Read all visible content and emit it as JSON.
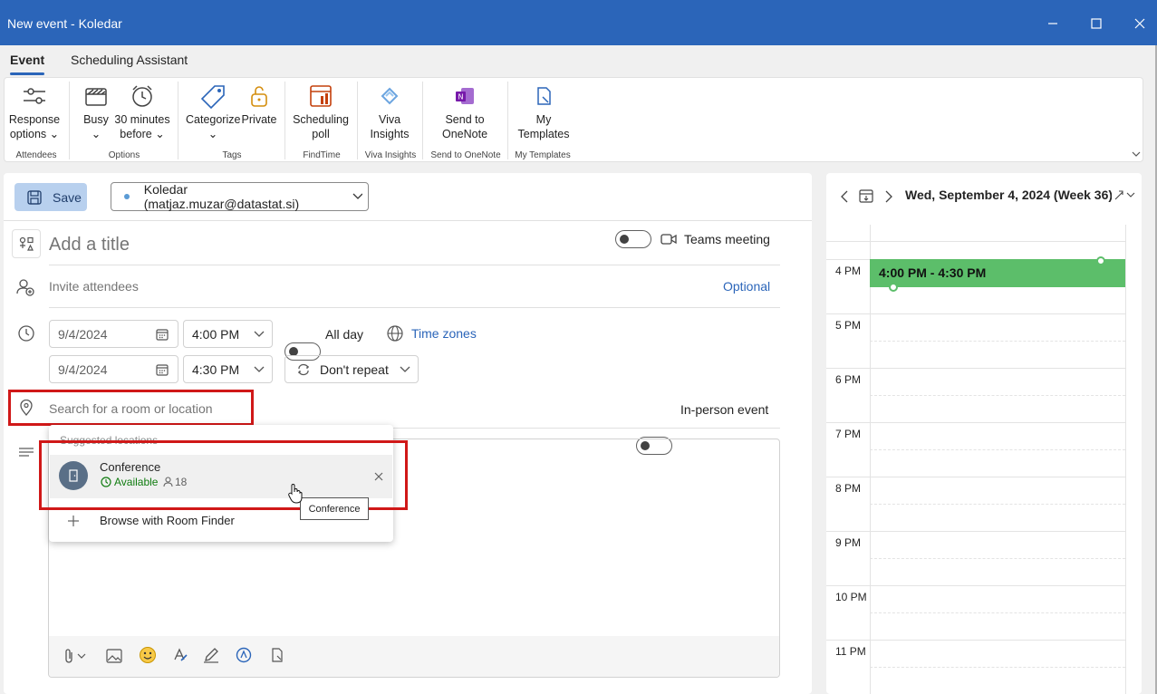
{
  "window": {
    "title": "New event - Koledar"
  },
  "tabs": [
    {
      "label": "Event"
    },
    {
      "label": "Scheduling Assistant"
    }
  ],
  "ribbon": {
    "response_options": "Response options",
    "busy": "Busy",
    "reminder": "30 minutes before",
    "categorize": "Categorize",
    "private": "Private",
    "scheduling_poll": "Scheduling poll",
    "viva_insights": "Viva Insights",
    "send_onenote": "Send to OneNote",
    "my_templates": "My Templates",
    "groups": {
      "attendees": "Attendees",
      "options": "Options",
      "tags": "Tags",
      "findtime": "FindTime",
      "viva": "Viva Insights",
      "onenote": "Send to OneNote",
      "templates": "My Templates"
    }
  },
  "form": {
    "save_label": "Save",
    "account": "Koledar (matjaz.muzar@datastat.si)",
    "title_placeholder": "Add a title",
    "teams_meeting": "Teams meeting",
    "invite_placeholder": "Invite attendees",
    "optional": "Optional",
    "start_date": "9/4/2024",
    "start_time": "4:00 PM",
    "all_day": "All day",
    "time_zones": "Time zones",
    "end_date": "9/4/2024",
    "end_time": "4:30 PM",
    "repeat": "Don't repeat",
    "location_placeholder": "Search for a room or location",
    "in_person": "In-person event"
  },
  "suggestions": {
    "header": "Suggested locations",
    "room_name": "Conference",
    "room_status": "Available",
    "room_capacity": "18",
    "browse": "Browse with Room Finder",
    "tooltip": "Conference"
  },
  "calendar": {
    "date_header": "Wed, September 4, 2024 (Week 36)",
    "hours": [
      "4 PM",
      "5 PM",
      "6 PM",
      "7 PM",
      "8 PM",
      "9 PM",
      "10 PM",
      "11 PM"
    ],
    "event_time": "4:00 PM - 4:30 PM"
  },
  "colors": {
    "titlebar": "#2b65b9",
    "event": "#5cbe6a",
    "highlight": "#d01818",
    "available": "#107c10"
  }
}
